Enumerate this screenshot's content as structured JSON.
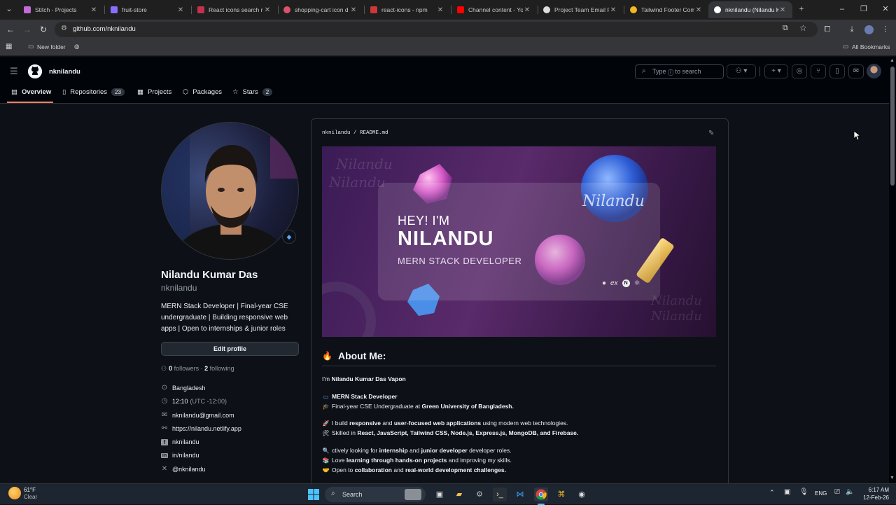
{
  "browser": {
    "tabs": [
      {
        "title": "Stitch - Projects",
        "color": "#c26bd6"
      },
      {
        "title": "fruit-store",
        "color": "#8a6cff"
      },
      {
        "title": "React icons search re",
        "color": "#c2314f"
      },
      {
        "title": "shopping-cart icon d",
        "color": "#d9546b"
      },
      {
        "title": "react-icons - npm",
        "color": "#cb3837"
      },
      {
        "title": "Channel content - Yo",
        "color": "#ff0000"
      },
      {
        "title": "Project Team Email R",
        "color": "#dddddd"
      },
      {
        "title": "Tailwind Footer Comp",
        "color": "#f2b824"
      },
      {
        "title": "nknilandu (Nilandu K",
        "color": "#ffffff"
      }
    ],
    "url": "github.com/nknilandu",
    "bookmarks": {
      "folder": "New folder",
      "all": "All Bookmarks"
    }
  },
  "github": {
    "header_user": "nknilandu",
    "search": {
      "prefix": "Type",
      "key": "/",
      "suffix": "to search"
    },
    "nav": [
      {
        "label": "Overview",
        "icon": "book-icon"
      },
      {
        "label": "Repositories",
        "icon": "repo-icon",
        "count": "23"
      },
      {
        "label": "Projects",
        "icon": "project-icon"
      },
      {
        "label": "Packages",
        "icon": "package-icon"
      },
      {
        "label": "Stars",
        "icon": "star-icon",
        "count": "2"
      }
    ],
    "profile": {
      "name": "Nilandu Kumar Das",
      "username": "nknilandu",
      "bio": "MERN Stack Developer | Final-year CSE undergraduate | Building responsive web apps | Open to internships & junior roles",
      "edit_label": "Edit profile",
      "followers": "0",
      "followers_label": "followers",
      "following": "2",
      "following_label": "following",
      "location": "Bangladesh",
      "time": "12:10",
      "tz": "(UTC -12:00)",
      "email": "nknilandu@gmail.com",
      "website": "https://nilandu.netlify.app",
      "facebook": "nknilandu",
      "linkedin": "in/nilandu",
      "twitter": "@nknilandu"
    },
    "readme": {
      "owner": "nknilandu",
      "file": "README.md",
      "banner": {
        "hey": "HEY! I'M",
        "name": "NILANDU",
        "role": "MERN STACK DEVELOPER",
        "signature": "Nilandu"
      },
      "about_title": "About Me:",
      "intro_prefix": "I'm",
      "intro_name": "Nilandu Kumar Das Vapon",
      "role": "MERN Stack Developer",
      "edu_prefix": "Final-year CSE Undergraduate at",
      "edu_school": "Green University of Bangladesh.",
      "build_line": {
        "a": "I build",
        "b": "responsive",
        "c": "and",
        "d": "user-focused web applications",
        "e": "using modern web technologies."
      },
      "skills_prefix": "Skilled in",
      "skills": "React, JavaScript, Tailwind CSS, Node.js, Express.js, MongoDB, and Firebase.",
      "looking": {
        "a": "ctively looking for",
        "b": "internship",
        "c": "and",
        "d": "junior developer",
        "e": "developer roles."
      },
      "learn": {
        "a": "Love",
        "b": "learning through hands-on projects",
        "c": "and improving my skills."
      },
      "open": {
        "a": "Open to",
        "b": "collaboration",
        "c": "and",
        "d": "real-world development challenges."
      }
    }
  },
  "taskbar": {
    "weather_temp": "61°F",
    "weather_desc": "Clear",
    "search": "Search",
    "lang": "ENG",
    "time": "6:17 AM",
    "date": "12-Feb-26"
  }
}
